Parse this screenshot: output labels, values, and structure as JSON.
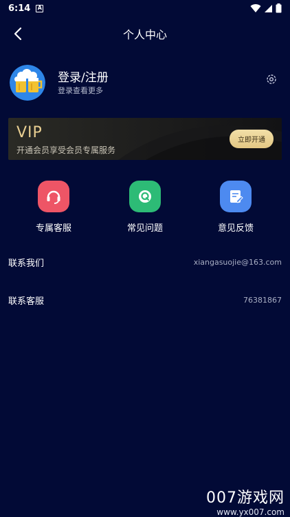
{
  "status_bar": {
    "time": "6:14",
    "notif_letter": "A"
  },
  "header": {
    "title": "个人中心"
  },
  "profile": {
    "title": "登录/注册",
    "subtitle": "登录查看更多"
  },
  "vip": {
    "title": "VIP",
    "desc": "开通会员享受会员专属服务",
    "button": "立即开通"
  },
  "quick_actions": [
    {
      "label": "专属客服",
      "color": "#ee5566"
    },
    {
      "label": "常见问题",
      "color": "#2dbb76"
    },
    {
      "label": "意见反馈",
      "color": "#4d8af0"
    }
  ],
  "contact_rows": [
    {
      "label": "联系我们",
      "value": "xiangasuojie@163.com"
    },
    {
      "label": "联系客服",
      "value": "76381867"
    }
  ],
  "watermark": {
    "brand": "007游戏网",
    "url": "www.yx007.com"
  }
}
